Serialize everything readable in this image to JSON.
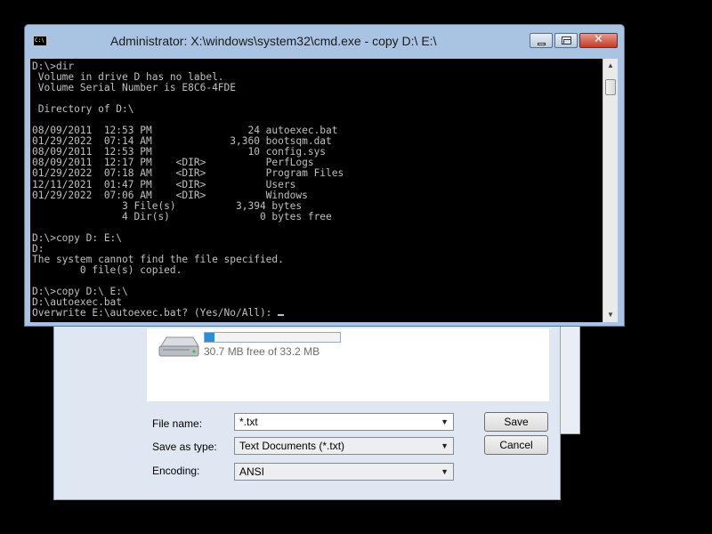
{
  "cmd_window": {
    "title": "Administrator: X:\\windows\\system32\\cmd.exe - copy  D:\\ E:\\",
    "icon": "cmd-icon",
    "icon_text": "C:\\",
    "caption_buttons": {
      "minimize": "minimize-icon",
      "maximize": "maximize-icon",
      "close": "✕"
    },
    "console_lines": [
      "D:\\>dir",
      " Volume in drive D has no label.",
      " Volume Serial Number is E8C6-4FDE",
      "",
      " Directory of D:\\",
      "",
      "08/09/2011  12:53 PM                24 autoexec.bat",
      "01/29/2022  07:14 AM             3,360 bootsqm.dat",
      "08/09/2011  12:53 PM                10 config.sys",
      "08/09/2011  12:17 PM    <DIR>          PerfLogs",
      "01/29/2022  07:18 AM    <DIR>          Program Files",
      "12/11/2021  01:47 PM    <DIR>          Users",
      "01/29/2022  07:06 AM    <DIR>          Windows",
      "               3 File(s)          3,394 bytes",
      "               4 Dir(s)               0 bytes free",
      "",
      "D:\\>copy D: E:\\",
      "D:",
      "The system cannot find the file specified.",
      "        0 file(s) copied.",
      "",
      "D:\\>copy D:\\ E:\\",
      "D:\\autoexec.bat",
      "Overwrite E:\\autoexec.bat? (Yes/No/All): "
    ],
    "colors": {
      "console_bg": "#000000",
      "console_fg": "#c0c0c0",
      "frame": "#a9c4e2"
    }
  },
  "save_dialog": {
    "drive": {
      "icon": "drive-icon",
      "free_text": "30.7 MB free of 33.2 MB",
      "used_fraction": 0.075
    },
    "file_name": {
      "label": "File name:",
      "value": "*.txt"
    },
    "save_as_type": {
      "label": "Save as type:",
      "value": "Text Documents (*.txt)"
    },
    "encoding": {
      "label": "Encoding:",
      "value": "ANSI"
    },
    "dropdown_icon": "▼",
    "save_button": "Save",
    "cancel_button": "Cancel"
  },
  "scrollbar": {
    "up": "▲",
    "down": "▼"
  }
}
